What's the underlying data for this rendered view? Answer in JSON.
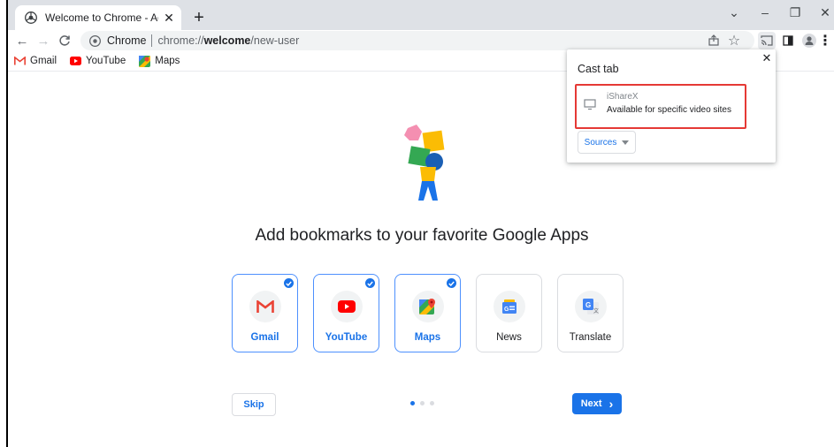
{
  "browser": {
    "tab_title": "Welcome to Chrome - Add book",
    "tab_close": "✕",
    "new_tab": "+",
    "window_controls": {
      "tab_search": "⌄",
      "minimize": "–",
      "restore": "❐",
      "close": "✕"
    },
    "omnibox": {
      "chip": "Chrome",
      "url_scheme": "chrome://",
      "url_host": "welcome",
      "url_path": "/new-user"
    },
    "icons": [
      "back-icon",
      "forward-icon",
      "reload-icon",
      "share-icon",
      "star-icon",
      "cast-icon",
      "side-panel-icon",
      "profile-icon",
      "menu-icon"
    ]
  },
  "bookmarks": [
    {
      "label": "Gmail",
      "icon": "gmail-icon"
    },
    {
      "label": "YouTube",
      "icon": "youtube-icon"
    },
    {
      "label": "Maps",
      "icon": "maps-icon"
    }
  ],
  "welcome": {
    "headline": "Add bookmarks to your favorite Google Apps",
    "apps": [
      {
        "label": "Gmail",
        "selected": true
      },
      {
        "label": "YouTube",
        "selected": true
      },
      {
        "label": "Maps",
        "selected": true
      },
      {
        "label": "News",
        "selected": false
      },
      {
        "label": "Translate",
        "selected": false
      }
    ],
    "skip_label": "Skip",
    "next_label": "Next",
    "next_arrow": "›",
    "page_index": 1,
    "page_count": 3
  },
  "cast": {
    "title": "Cast tab",
    "close": "✕",
    "sink_name": "iShareX",
    "sink_status": "Available for specific video sites",
    "sources_label": "Sources"
  },
  "colors": {
    "accent": "#1a73e8",
    "highlight": "#e53935",
    "tabstrip": "#dee1e6"
  }
}
